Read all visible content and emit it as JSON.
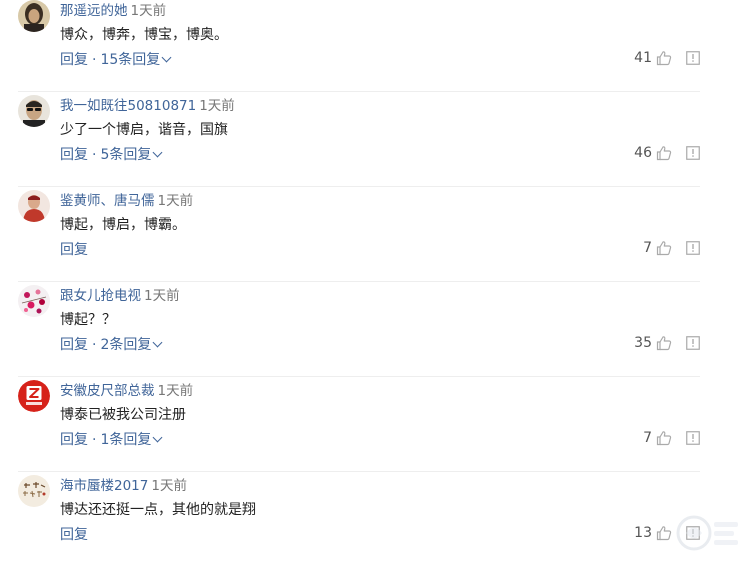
{
  "colors": {
    "link": "#406599",
    "time": "#777777",
    "text": "#222222",
    "count": "#555555",
    "icon": "#aaaaaa",
    "divider": "#eeeeee"
  },
  "comments": [
    {
      "username": "那遥远的她",
      "time": "1天前",
      "content": "博众，博奔，博宝，博奥。",
      "reply_label": "回复",
      "separator": "·",
      "replies_label": "15条回复",
      "likes": "41",
      "avatar_icon": "avatar-dark-portrait"
    },
    {
      "username": "我一如既往50810871",
      "time": "1天前",
      "content": "少了一个博启，谐音，国旗",
      "reply_label": "回复",
      "separator": "·",
      "replies_label": "5条回复",
      "likes": "46",
      "avatar_icon": "avatar-sunglasses-man"
    },
    {
      "username": "鉴黄师、唐马儒",
      "time": "1天前",
      "content": "博起，博启，博霸。",
      "reply_label": "回复",
      "separator": "",
      "replies_label": "",
      "likes": "7",
      "avatar_icon": "avatar-red-figure"
    },
    {
      "username": "跟女儿抢电视",
      "time": "1天前",
      "content": "博起？？",
      "reply_label": "回复",
      "separator": "·",
      "replies_label": "2条回复",
      "likes": "35",
      "avatar_icon": "avatar-floral"
    },
    {
      "username": "安徽皮尺部总裁",
      "time": "1天前",
      "content": "博泰已被我公司注册",
      "reply_label": "回复",
      "separator": "·",
      "replies_label": "1条回复",
      "likes": "7",
      "avatar_icon": "avatar-red-logo"
    },
    {
      "username": "海市蜃楼2017",
      "time": "1天前",
      "content": "博达还还挺一点，其他的就是翔",
      "reply_label": "回复",
      "separator": "",
      "replies_label": "",
      "likes": "13",
      "avatar_icon": "avatar-calligraphy"
    }
  ],
  "icons": {
    "like": "thumbs-up-icon",
    "report": "report-icon",
    "expand": "chevron-down-icon"
  }
}
